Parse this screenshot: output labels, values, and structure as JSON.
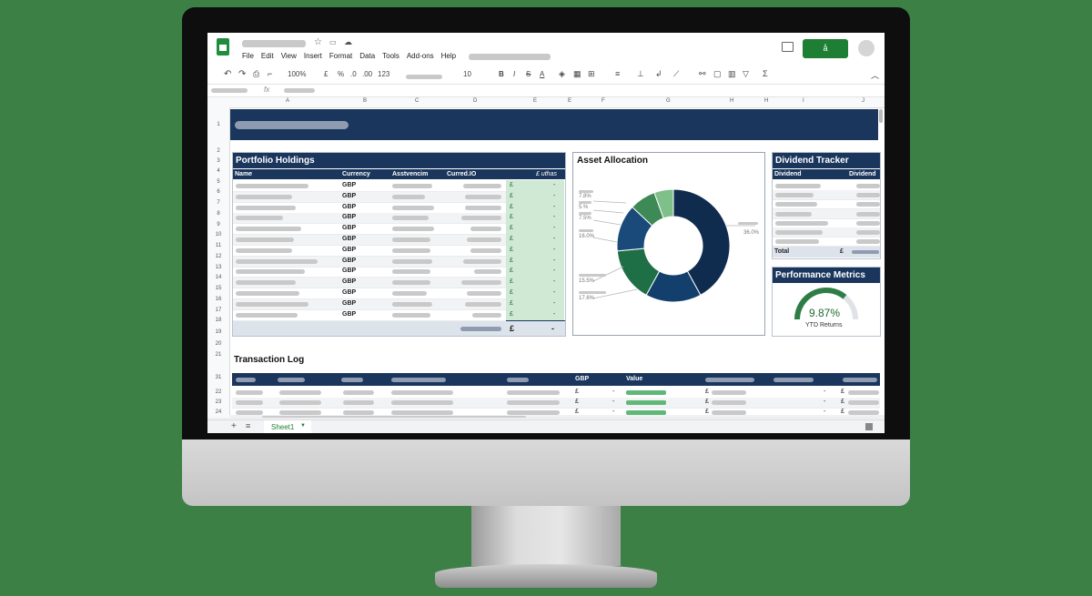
{
  "menu": [
    "File",
    "Edit",
    "View",
    "Insert",
    "Format",
    "Data",
    "Tools",
    "Add-ons",
    "Help"
  ],
  "share_button": "å",
  "toolbar": {
    "zoom": "100%",
    "currency": "£",
    "percent": "%",
    "dec1": ".0",
    "dec2": ".00",
    "format": "123",
    "font_size": "10",
    "bold": "B",
    "italic": "I",
    "strike": "S",
    "text_color": "A"
  },
  "columns": [
    "A",
    "B",
    "C",
    "D",
    "E",
    "E",
    "F",
    "G",
    "H",
    "H",
    "I",
    "J"
  ],
  "rows_top": [
    "1",
    "2",
    "3",
    "4",
    "5",
    "6",
    "7",
    "8",
    "9",
    "10",
    "11",
    "12",
    "13",
    "14",
    "15",
    "16",
    "17",
    "18",
    "19",
    "20",
    "21"
  ],
  "rows_bottom": [
    "31",
    "22",
    "23",
    "24"
  ],
  "portfolio": {
    "title": "Portfolio Holdings",
    "headers": [
      "Name",
      "Currency",
      "Asstvencim",
      "Curred.IO",
      "£ uthas"
    ],
    "currency": [
      "GBP",
      "GBP",
      "GBP",
      "GBP",
      "GBP",
      "GBP",
      "GBP",
      "GBP",
      "GBP",
      "GBP",
      "GBP",
      "GBP",
      "GBP"
    ],
    "pound": "£",
    "dash": "-",
    "total_pound": "£",
    "total_dash": "-"
  },
  "allocation": {
    "title": "Asset Allocation",
    "labels_left": [
      "7.8%",
      "5.%",
      "7.5%",
      "16.0%",
      "15.5%",
      "17.6%"
    ],
    "label_right": "36.0%"
  },
  "chart_data": {
    "type": "pie",
    "title": "Asset Allocation",
    "values": [
      42.0,
      16.0,
      15.5,
      13.5,
      7.5,
      5.5
    ],
    "colors": [
      "#0f2c4f",
      "#123f6b",
      "#1e6f45",
      "#1a4a7a",
      "#3e8a57",
      "#7fbf8a"
    ],
    "labels_shown": [
      "36.0%",
      "17.6%",
      "15.5%",
      "16.0%",
      "7.5%",
      "5.%",
      "7.8%"
    ]
  },
  "dividend": {
    "title": "Dividend Tracker",
    "headers": [
      "Dividend",
      "Dividend"
    ],
    "total_label": "Total",
    "total_pound": "£"
  },
  "performance": {
    "title": "Performance Metrics",
    "value": "9.87%",
    "label": "YTD Returns",
    "fraction": 0.72
  },
  "transactions": {
    "title": "Transaction Log",
    "headers": [
      "GBP",
      "Value"
    ],
    "pound": "£",
    "dash": "-"
  },
  "sheet_tab": "Sheet1",
  "colors": {
    "navy": "#1a365d",
    "green": "#1e7e34",
    "bg": "#3d8046"
  }
}
